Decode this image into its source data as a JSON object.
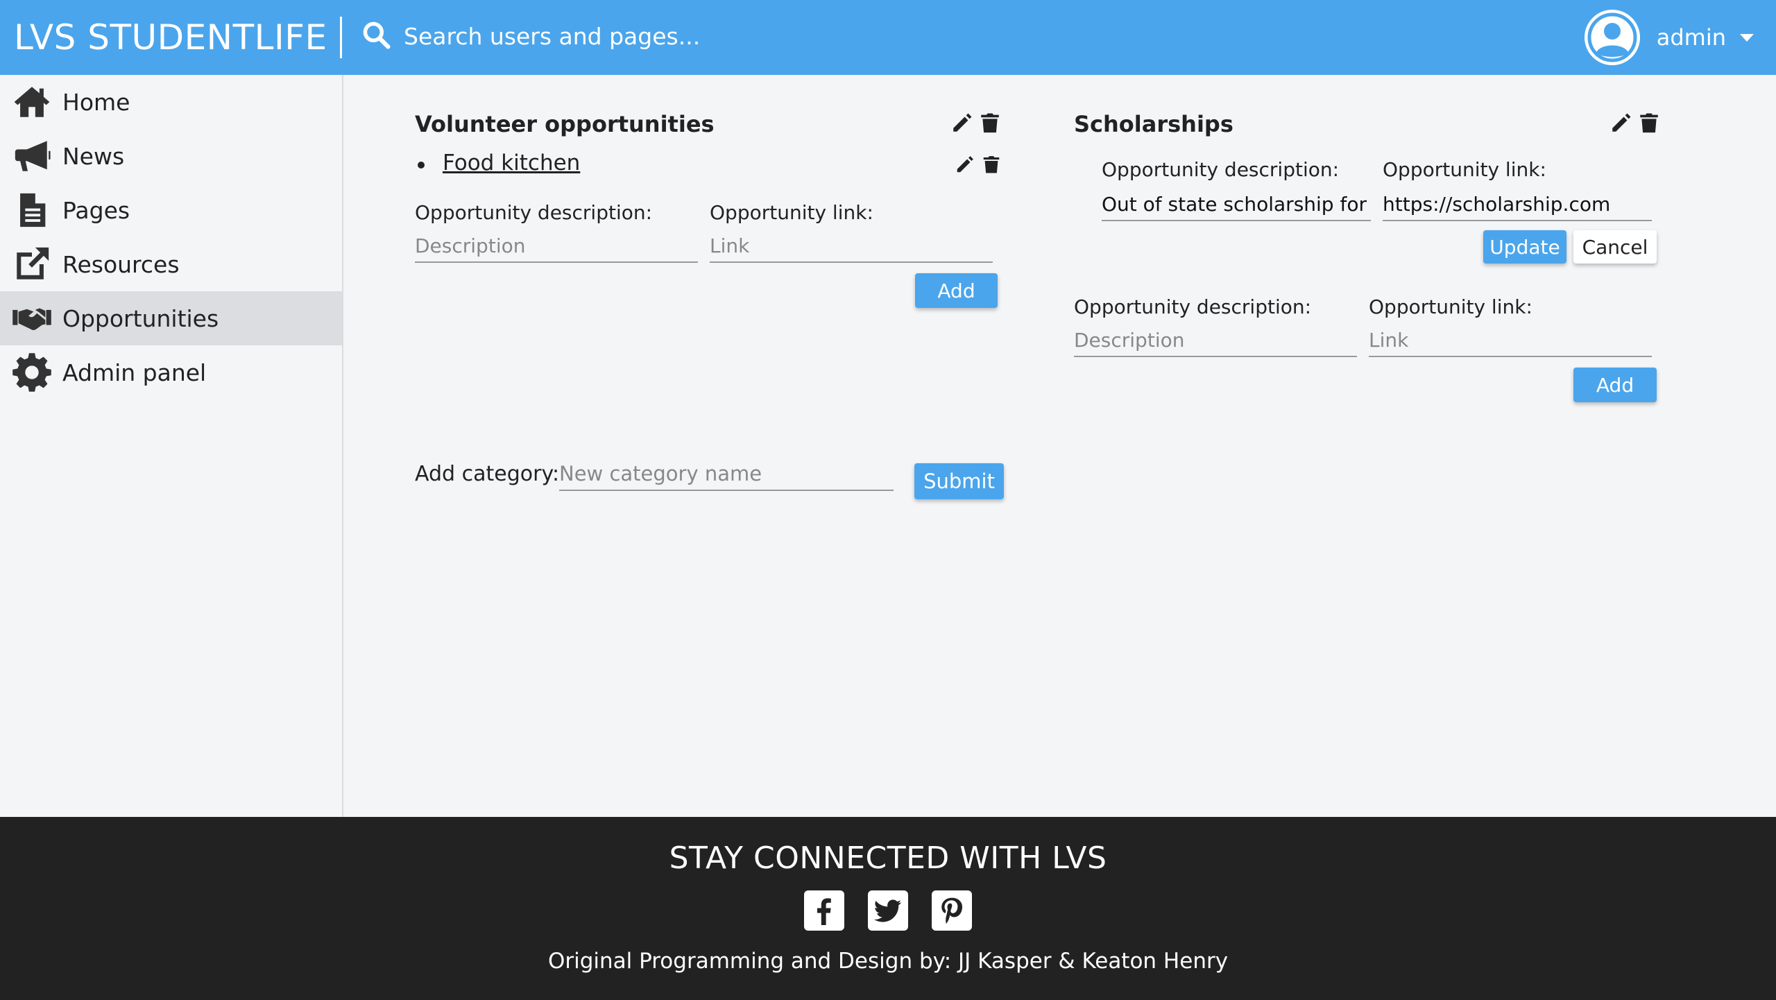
{
  "header": {
    "brand": "LVS STUDENTLIFE",
    "search_placeholder": "Search users and pages...",
    "user_name": "admin"
  },
  "sidebar": {
    "items": [
      {
        "label": "Home",
        "icon": "home-icon"
      },
      {
        "label": "News",
        "icon": "megaphone-icon"
      },
      {
        "label": "Pages",
        "icon": "document-icon"
      },
      {
        "label": "Resources",
        "icon": "external-link-icon"
      },
      {
        "label": "Opportunities",
        "icon": "handshake-icon",
        "active": true
      },
      {
        "label": "Admin panel",
        "icon": "gear-icon"
      }
    ]
  },
  "volunteer": {
    "title": "Volunteer opportunities",
    "items": [
      {
        "label": "Food kitchen"
      }
    ],
    "desc_label": "Opportunity description:",
    "link_label": "Opportunity link:",
    "desc_placeholder": "Description",
    "link_placeholder": "Link",
    "add_label": "Add"
  },
  "scholarships": {
    "title": "Scholarships",
    "edit": {
      "desc_label": "Opportunity description:",
      "link_label": "Opportunity link:",
      "desc_value": "Out of state scholarship for NYU",
      "link_value": "https://scholarship.com",
      "update_label": "Update",
      "cancel_label": "Cancel"
    },
    "desc_label": "Opportunity description:",
    "link_label": "Opportunity link:",
    "desc_placeholder": "Description",
    "link_placeholder": "Link",
    "add_label": "Add"
  },
  "add_category": {
    "label": "Add category:",
    "placeholder": "New category name",
    "submit_label": "Submit"
  },
  "footer": {
    "title": "STAY CONNECTED WITH LVS",
    "socials": [
      "facebook-icon",
      "twitter-icon",
      "pinterest-icon"
    ],
    "credits": "Original Programming and Design by: JJ Kasper & Keaton Henry"
  },
  "colors": {
    "accent": "#4aa5ec",
    "footer_bg": "#222222",
    "active_item": "#dcdde0"
  }
}
